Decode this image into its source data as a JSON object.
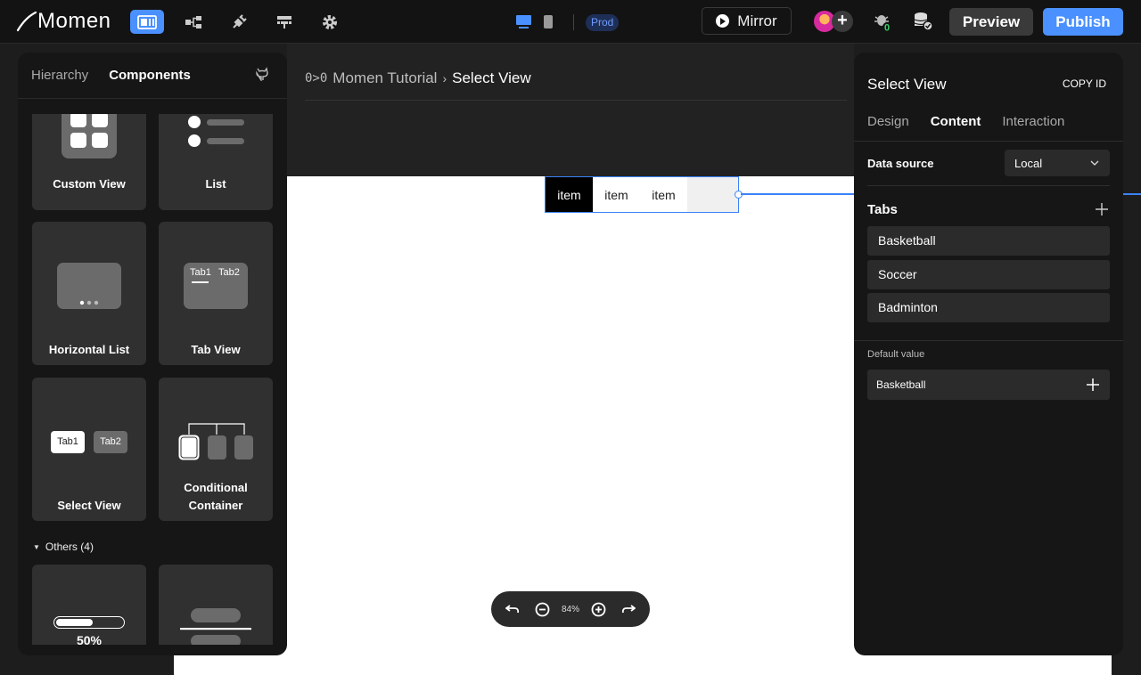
{
  "app": {
    "logo_text": "Momen"
  },
  "topbar": {
    "env_badge": "Prod",
    "mirror_label": "Mirror",
    "avatar_add": "+",
    "preview_label": "Preview",
    "publish_label": "Publish",
    "accent_color": "#4a90ff"
  },
  "breadcrumb": {
    "icon_text": "0>0",
    "project": "Momen Tutorial",
    "separator": "›",
    "current": "Select View"
  },
  "canvas": {
    "select_view_items": [
      "item",
      "item",
      "item"
    ],
    "selected_index": 0
  },
  "zoom": {
    "level": "84%"
  },
  "left_panel": {
    "tabs": [
      "Hierarchy",
      "Components"
    ],
    "active_tab": "Components",
    "components": [
      {
        "label": "Custom View",
        "icon": "grid-icon"
      },
      {
        "label": "List",
        "icon": "list-icon"
      },
      {
        "label": "Horizontal List",
        "icon": "carousel-icon"
      },
      {
        "label": "Tab View",
        "icon": "tab-view-icon",
        "tab1": "Tab1",
        "tab2": "Tab2"
      },
      {
        "label": "Select View",
        "icon": "select-view-icon",
        "tab1": "Tab1",
        "tab2": "Tab2"
      },
      {
        "label_line1": "Conditional",
        "label_line2": "Container",
        "icon": "conditional-icon"
      }
    ],
    "others_label": "Others (4)",
    "others_cards": [
      {
        "icon": "progress-icon",
        "percent_text": "50%",
        "progress": 0.55
      },
      {
        "icon": "divider-icon"
      }
    ]
  },
  "right_panel": {
    "title": "Select View",
    "copy_id": "COPY ID",
    "tabs": [
      "Design",
      "Content",
      "Interaction"
    ],
    "active_tab": "Content",
    "data_source_label": "Data source",
    "data_source_value": "Local",
    "tabs_header": "Tabs",
    "tabs_items": [
      "Basketball",
      "Soccer",
      "Badminton"
    ],
    "default_value_label": "Default value",
    "default_value": "Basketball"
  }
}
